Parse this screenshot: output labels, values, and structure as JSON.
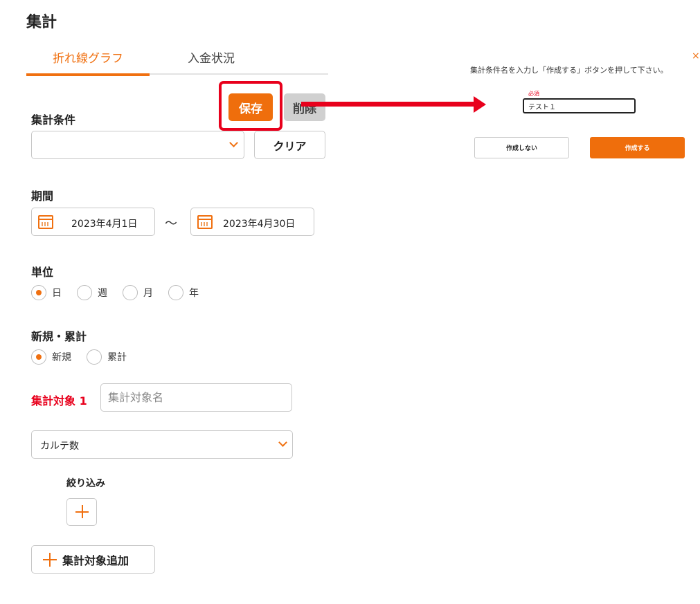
{
  "page": {
    "title": "集計"
  },
  "tabs": [
    {
      "label": "折れ線グラフ",
      "active": true
    },
    {
      "label": "入金状況",
      "active": false
    }
  ],
  "toolbar": {
    "save_label": "保存",
    "delete_label": "削除"
  },
  "conditions": {
    "label": "集計条件",
    "select_value": "",
    "clear_label": "クリア"
  },
  "period": {
    "label": "期間",
    "start": "2023年4月1日",
    "separator": "〜",
    "end": "2023年4月30日"
  },
  "unit": {
    "label": "単位",
    "options": [
      "日",
      "週",
      "月",
      "年"
    ],
    "selected": "日"
  },
  "mode": {
    "label": "新規・累計",
    "options": [
      "新規",
      "累計"
    ],
    "selected": "新規"
  },
  "target": {
    "label": "集計対象 1",
    "name_placeholder": "集計対象名",
    "select_value": "カルテ数",
    "filter_label": "絞り込み",
    "add_target_label": "集計対象追加"
  },
  "dialog": {
    "close": "×",
    "message": "集計条件名を入力し「作成する」ボタンを押して下さい。",
    "required": "必須",
    "input_value": "テスト１",
    "cancel_label": "作成しない",
    "create_label": "作成する"
  },
  "colors": {
    "accent": "#ef6e0c",
    "annotation": "#e8001c"
  }
}
